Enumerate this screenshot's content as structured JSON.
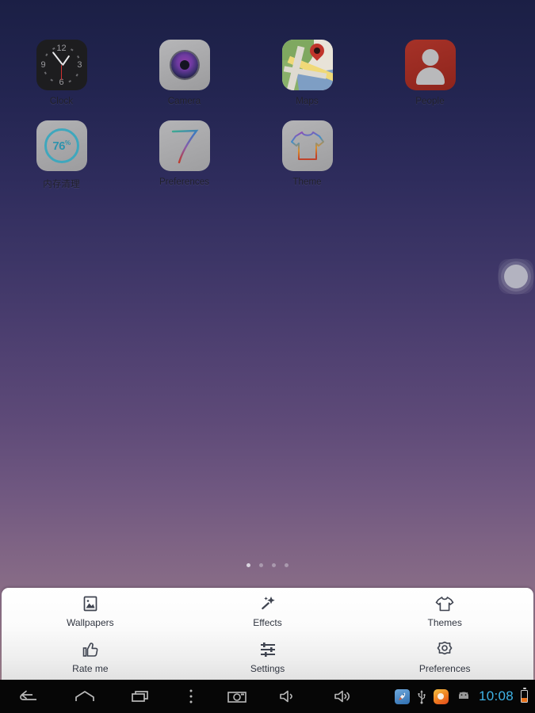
{
  "wallpaper": {
    "gradient_top": "#1b1f45",
    "gradient_mid": "#5e4a78",
    "gradient_bottom": "#9d7f8d"
  },
  "home_screen": {
    "rows": [
      [
        {
          "label": "Clock",
          "icon": "clock-icon",
          "clock": {
            "n12": "12",
            "n3": "3",
            "n6": "6",
            "n9": "9"
          }
        },
        {
          "label": "Camera",
          "icon": "camera-icon"
        },
        {
          "label": "Maps",
          "icon": "maps-icon"
        },
        {
          "label": "People",
          "icon": "people-icon"
        }
      ],
      [
        {
          "label": "内存清理",
          "icon": "memory-cleaner-icon",
          "gauge_value": "76",
          "gauge_unit": "%",
          "gauge_color": "#3fa7bd"
        },
        {
          "label": "Preferences",
          "icon": "seven-icon"
        },
        {
          "label": "Theme",
          "icon": "tshirt-icon"
        }
      ]
    ]
  },
  "page_indicator": {
    "count": 4,
    "active_index": 0
  },
  "assistive_button": {
    "name": "floating-assistive-touch"
  },
  "option_panel": {
    "rows": [
      [
        {
          "label": "Wallpapers",
          "icon": "image-icon"
        },
        {
          "label": "Effects",
          "icon": "magic-wand-icon"
        },
        {
          "label": "Themes",
          "icon": "tshirt-icon"
        }
      ],
      [
        {
          "label": "Rate me",
          "icon": "thumbs-up-icon"
        },
        {
          "label": "Settings",
          "icon": "sliders-icon"
        },
        {
          "label": "Preferences",
          "icon": "gear-icon"
        }
      ]
    ]
  },
  "navbar": {
    "buttons": [
      {
        "name": "back-icon"
      },
      {
        "name": "home-icon"
      },
      {
        "name": "recents-icon"
      },
      {
        "name": "overflow-menu-icon"
      },
      {
        "name": "screenshot-icon"
      },
      {
        "name": "volume-down-icon"
      },
      {
        "name": "volume-up-icon"
      }
    ],
    "tray": [
      {
        "name": "rocket-launcher-icon"
      },
      {
        "name": "usb-icon"
      },
      {
        "name": "orange-app-icon"
      },
      {
        "name": "android-robot-icon"
      }
    ],
    "time": "10:08",
    "time_color": "#3fb4e8",
    "battery": {
      "name": "battery-low-icon",
      "level_color": "#e8711a"
    }
  }
}
